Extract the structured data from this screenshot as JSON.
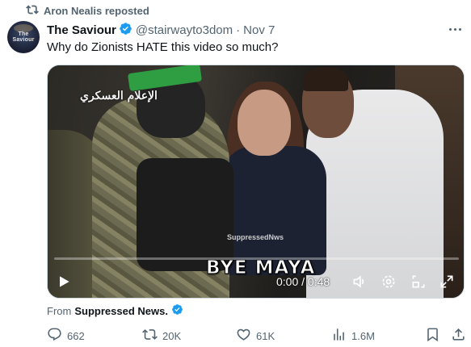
{
  "repost": {
    "text": "Aron Nealis reposted",
    "icon": "repost-icon"
  },
  "author": {
    "avatar_text": "The Saviour",
    "display_name": "The Saviour",
    "verified_icon": "verified-badge-icon",
    "handle": "@stairwayto3dom",
    "separator": "·",
    "date": "Nov 7"
  },
  "tweet": {
    "text": "Why do Zionists HATE this video so much?"
  },
  "video": {
    "channel_logo": "الإعلام العسكري",
    "watermark": "SuppressedNws",
    "caption": "BYE MAYA",
    "time": "0:00 / 0:48",
    "progress": 0,
    "accent": "#1d9bf0",
    "controls": {
      "play": "play-icon",
      "volume": "volume-icon",
      "settings": "settings-icon",
      "pip": "picture-in-picture-icon",
      "fullscreen": "fullscreen-icon"
    }
  },
  "from": {
    "prefix": "From",
    "source": "Suppressed News."
  },
  "actions": {
    "replies": "662",
    "reposts": "20K",
    "likes": "61K",
    "views": "1.6M"
  },
  "colors": {
    "secondary_text": "#536471",
    "primary_text": "#0f1419",
    "verified": "#1d9bf0"
  }
}
